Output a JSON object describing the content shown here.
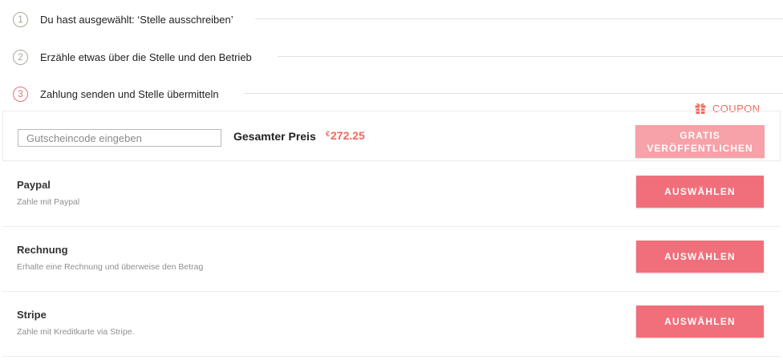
{
  "steps": [
    {
      "number": "1",
      "label": "Du hast ausgewählt: ‘Stelle ausschreiben’",
      "state": "done"
    },
    {
      "number": "2",
      "label": "Erzähle etwas über die Stelle und den Betrieb",
      "state": "done"
    },
    {
      "number": "3",
      "label": "Zahlung senden und Stelle übermitteln",
      "state": "active"
    }
  ],
  "coupon_link": {
    "label": "COUPON",
    "icon": "gift-icon"
  },
  "price_box": {
    "coupon_placeholder": "Gutscheincode eingeben",
    "coupon_value": "",
    "total_label": "Gesamter Preis",
    "currency_symbol": "€",
    "total_amount": "272.25",
    "free_publish_line1": "GRATIS",
    "free_publish_line2": "VERÖFFENTLICHEN"
  },
  "payment_methods": [
    {
      "title": "Paypal",
      "description": "Zahle mit Paypal",
      "button_label": "AUSWÄHLEN"
    },
    {
      "title": "Rechnung",
      "description": "Erhalte eine Rechnung und überweise den Betrag",
      "button_label": "AUSWÄHLEN"
    },
    {
      "title": "Stripe",
      "description": "Zahle mit Kreditkarte via Stripe.",
      "button_label": "AUSWÄHLEN"
    }
  ],
  "colors": {
    "accent": "#f06f7a",
    "accent_disabled": "#f6a2a8",
    "price": "#ef6a5b",
    "step_done": "#a9a99a",
    "step_active": "#e5707b"
  }
}
